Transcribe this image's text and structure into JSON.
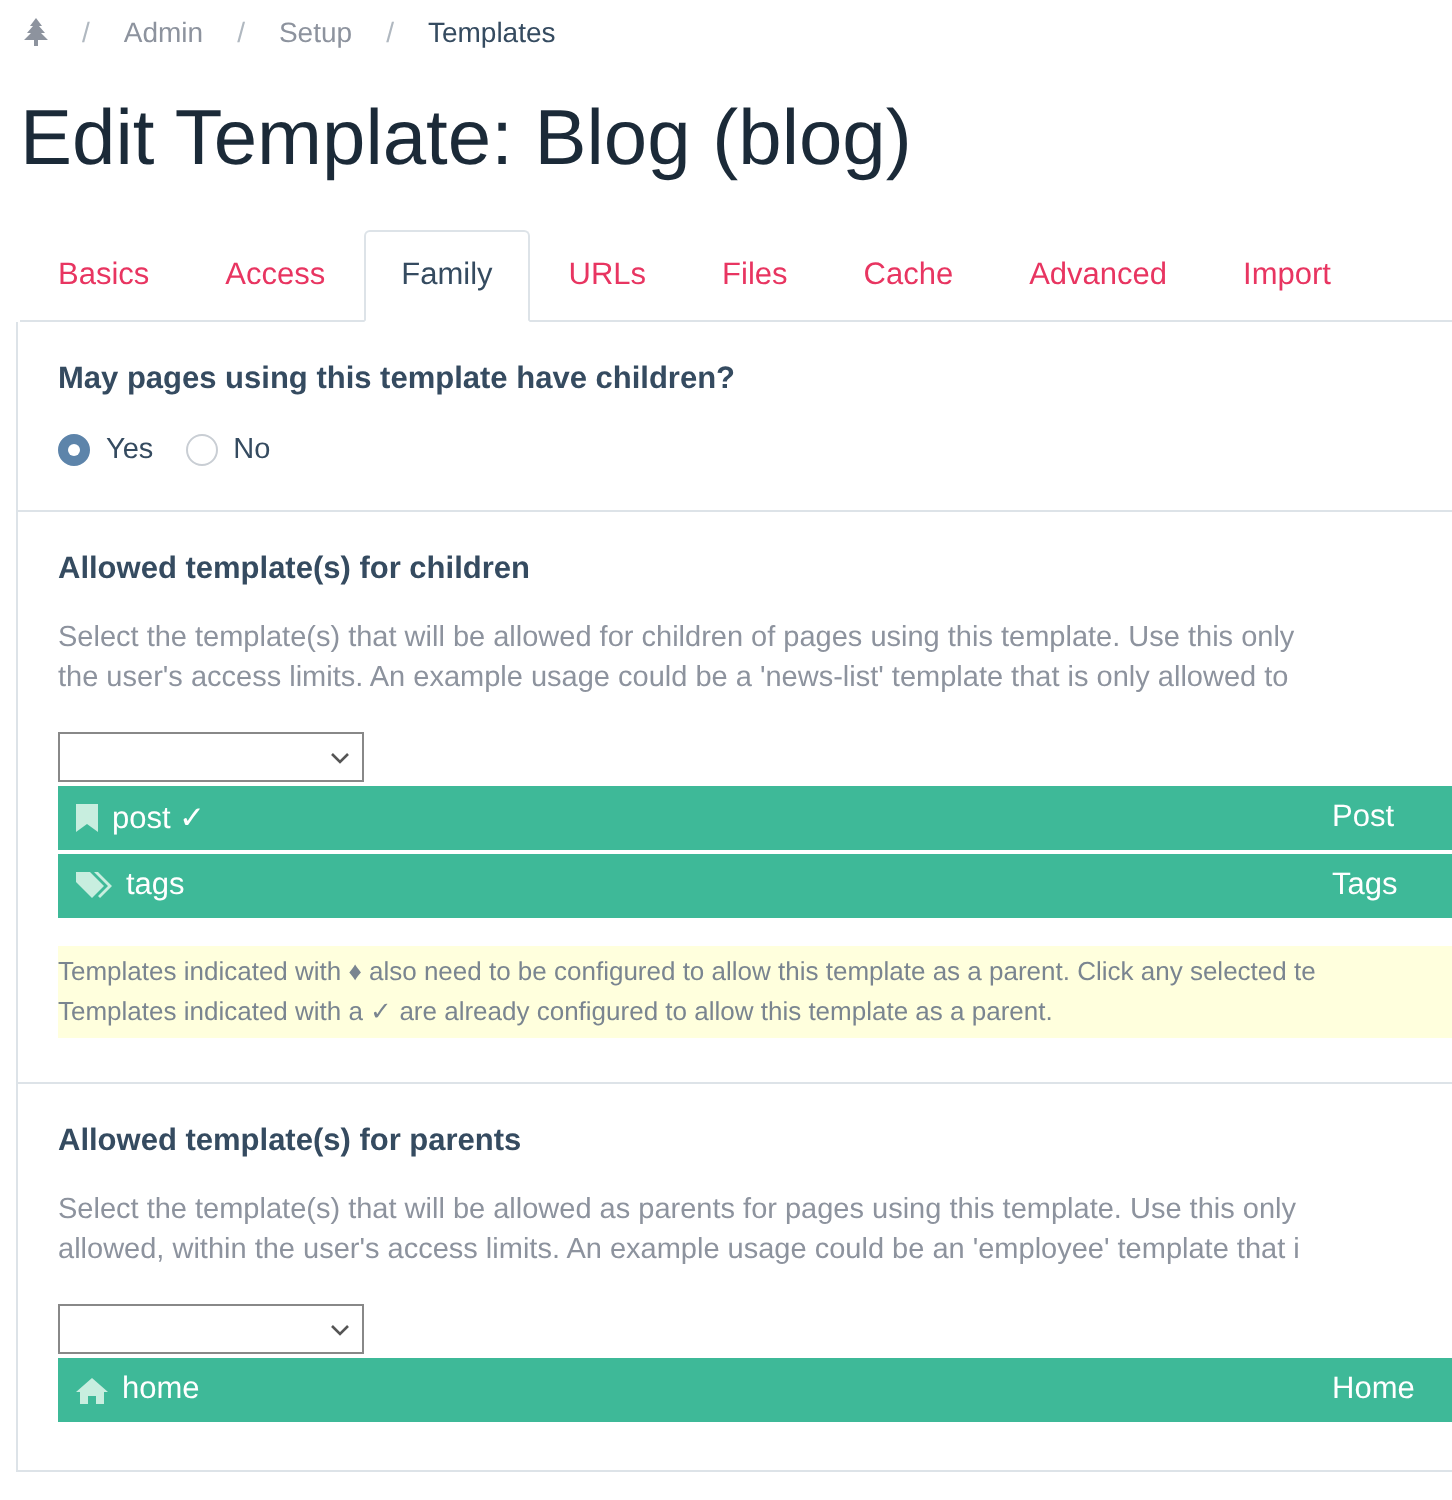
{
  "breadcrumb": [
    {
      "separator": "/",
      "label": "Admin"
    },
    {
      "separator": "/",
      "label": "Setup"
    },
    {
      "separator": "/",
      "label": "Templates"
    }
  ],
  "title": "Edit Template: Blog (blog)",
  "tabs": [
    {
      "label": "Basics",
      "selected": false
    },
    {
      "label": "Access",
      "selected": false
    },
    {
      "label": "Family",
      "selected": true
    },
    {
      "label": "URLs",
      "selected": false
    },
    {
      "label": "Files",
      "selected": false
    },
    {
      "label": "Cache",
      "selected": false
    },
    {
      "label": "Advanced",
      "selected": false
    },
    {
      "label": "Import",
      "selected": false
    }
  ],
  "children_question": {
    "label": "May pages using this template have children?",
    "options": [
      {
        "label": "Yes",
        "selected": true
      },
      {
        "label": "No",
        "selected": false
      }
    ]
  },
  "sections": [
    {
      "heading": "Allowed template(s) for children",
      "description": [
        "Select the template(s) that will be allowed for children of pages using this template. Use this only",
        "the user's access limits. An example usage could be a 'news-list' template that is only allowed to"
      ],
      "items": [
        {
          "name": "post ✓",
          "label": "Post",
          "kind": "bookmark"
        },
        {
          "name": "tags",
          "label": "Tags",
          "kind": "tags"
        }
      ],
      "notes": [
        "Templates indicated with ♦ also need to be configured to allow this template as a parent. Click any selected te",
        "Templates indicated with a ✓ are already configured to allow this template as a parent."
      ]
    },
    {
      "heading": "Allowed template(s) for parents",
      "description": [
        "Select the template(s) that will be allowed as parents for pages using this template. Use this only",
        "allowed, within the user's access limits. An example usage could be an 'employee' template that i"
      ],
      "items": [
        {
          "name": "home",
          "label": "Home",
          "kind": "home"
        }
      ]
    }
  ]
}
